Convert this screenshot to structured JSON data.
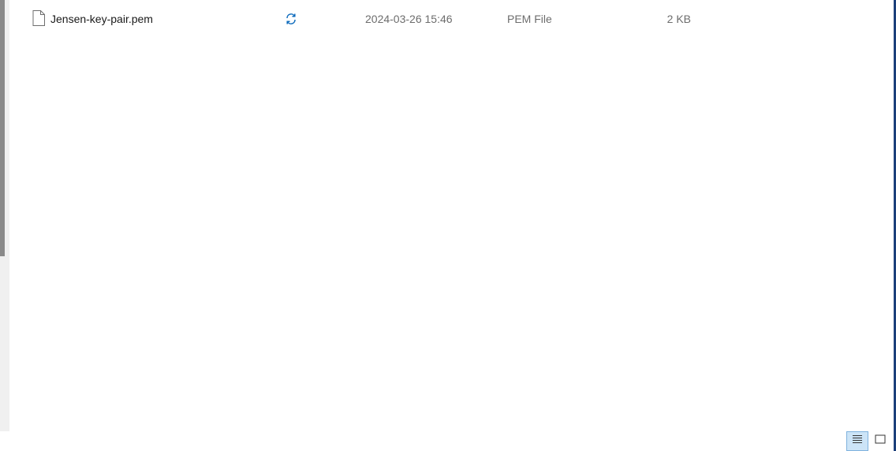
{
  "file_list": {
    "rows": [
      {
        "icon": "document-icon",
        "name": "Jensen-key-pair.pem",
        "status_icon": "sync-icon",
        "date_modified": "2024-03-26 15:46",
        "type": "PEM File",
        "size": "2 KB"
      }
    ]
  },
  "status_bar": {
    "views": [
      {
        "icon": "details-view-icon",
        "active": true
      },
      {
        "icon": "large-icons-view-icon",
        "active": false
      }
    ]
  },
  "colors": {
    "sync_blue": "#0f6cbd",
    "secondary_text": "#6d6d6d",
    "active_view_bg": "#cce4f7"
  }
}
